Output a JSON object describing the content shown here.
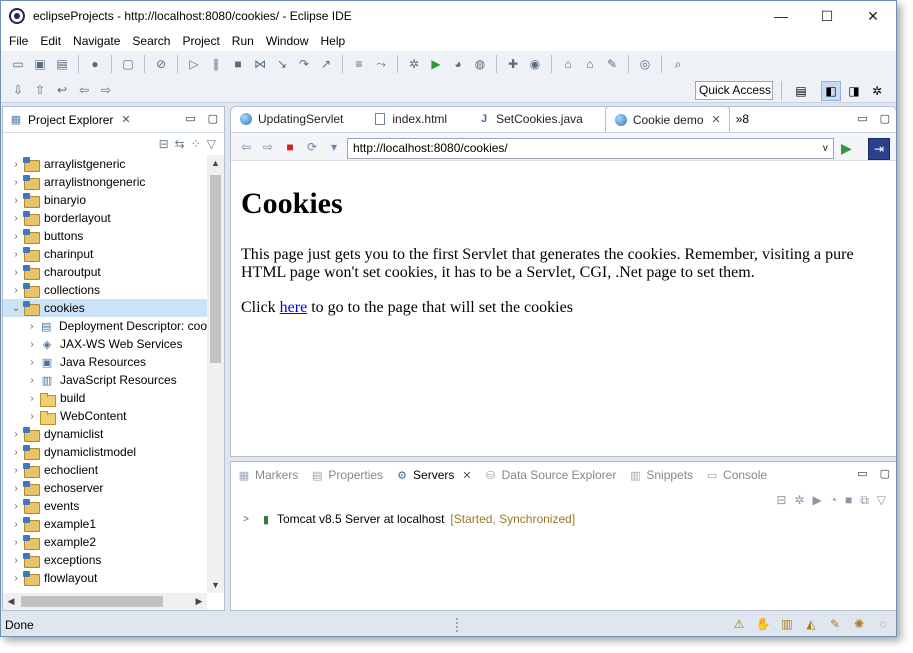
{
  "window": {
    "title": "eclipseProjects - http://localhost:8080/cookies/ - Eclipse IDE",
    "minimize": "—",
    "maximize": "☐",
    "close": "✕"
  },
  "menu": [
    "File",
    "Edit",
    "Navigate",
    "Search",
    "Project",
    "Run",
    "Window",
    "Help"
  ],
  "toolbar": {
    "quick_access": "Quick Access"
  },
  "explorer": {
    "title": "Project Explorer",
    "close": "✕",
    "items": [
      {
        "label": "arraylistgeneric",
        "level": 0,
        "twisty": ">",
        "icon": "project"
      },
      {
        "label": "arraylistnongeneric",
        "level": 0,
        "twisty": ">",
        "icon": "project"
      },
      {
        "label": "binaryio",
        "level": 0,
        "twisty": ">",
        "icon": "project"
      },
      {
        "label": "borderlayout",
        "level": 0,
        "twisty": ">",
        "icon": "project"
      },
      {
        "label": "buttons",
        "level": 0,
        "twisty": ">",
        "icon": "project"
      },
      {
        "label": "charinput",
        "level": 0,
        "twisty": ">",
        "icon": "project"
      },
      {
        "label": "charoutput",
        "level": 0,
        "twisty": ">",
        "icon": "project"
      },
      {
        "label": "collections",
        "level": 0,
        "twisty": ">",
        "icon": "project"
      },
      {
        "label": "cookies",
        "level": 0,
        "twisty": "v",
        "icon": "project",
        "selected": true
      },
      {
        "label": "Deployment Descriptor: coo",
        "level": 1,
        "twisty": ">",
        "icon": "descriptor"
      },
      {
        "label": "JAX-WS Web Services",
        "level": 1,
        "twisty": ">",
        "icon": "webservice"
      },
      {
        "label": "Java Resources",
        "level": 1,
        "twisty": ">",
        "icon": "java-resources"
      },
      {
        "label": "JavaScript Resources",
        "level": 1,
        "twisty": ">",
        "icon": "js-resources"
      },
      {
        "label": "build",
        "level": 1,
        "twisty": ">",
        "icon": "folder"
      },
      {
        "label": "WebContent",
        "level": 1,
        "twisty": ">",
        "icon": "folder"
      },
      {
        "label": "dynamiclist",
        "level": 0,
        "twisty": ">",
        "icon": "project"
      },
      {
        "label": "dynamiclistmodel",
        "level": 0,
        "twisty": ">",
        "icon": "project"
      },
      {
        "label": "echoclient",
        "level": 0,
        "twisty": ">",
        "icon": "project"
      },
      {
        "label": "echoserver",
        "level": 0,
        "twisty": ">",
        "icon": "project"
      },
      {
        "label": "events",
        "level": 0,
        "twisty": ">",
        "icon": "project"
      },
      {
        "label": "example1",
        "level": 0,
        "twisty": ">",
        "icon": "project"
      },
      {
        "label": "example2",
        "level": 0,
        "twisty": ">",
        "icon": "project"
      },
      {
        "label": "exceptions",
        "level": 0,
        "twisty": ">",
        "icon": "project"
      },
      {
        "label": "flowlayout",
        "level": 0,
        "twisty": ">",
        "icon": "project"
      }
    ]
  },
  "editor": {
    "tabs": [
      {
        "label": "UpdatingServlet",
        "icon": "globe",
        "active": false
      },
      {
        "label": "index.html",
        "icon": "doc",
        "active": false
      },
      {
        "label": "SetCookies.java",
        "icon": "java",
        "active": false
      },
      {
        "label": "Cookie demo",
        "icon": "globe",
        "active": true
      }
    ],
    "active_close": "✕",
    "overflow_label": "»8",
    "url": "http://localhost:8080/cookies/"
  },
  "page": {
    "heading": "Cookies",
    "paragraph": "This page just gets you to the first Servlet that generates the cookies. Remember, visiting a pure HTML page won't set cookies, it has to be a Servlet, CGI, .Net page to set them.",
    "click_prefix": "Click ",
    "link_text": "here",
    "click_suffix": " to go to the page that will set the cookies"
  },
  "servers_view": {
    "tabs": [
      {
        "label": "Markers",
        "active": false
      },
      {
        "label": "Properties",
        "active": false
      },
      {
        "label": "Servers",
        "active": true
      },
      {
        "label": "Data Source Explorer",
        "active": false
      },
      {
        "label": "Snippets",
        "active": false
      },
      {
        "label": "Console",
        "active": false
      }
    ],
    "close": "✕",
    "server_name": "Tomcat v8.5 Server at localhost",
    "server_status": "[Started, Synchronized]"
  },
  "status": {
    "text": "Done"
  },
  "colors": {
    "accent": "#3f79c2",
    "selection": "#cde3f8",
    "link": "#0000ee",
    "status_text": "#9a7a2a"
  }
}
